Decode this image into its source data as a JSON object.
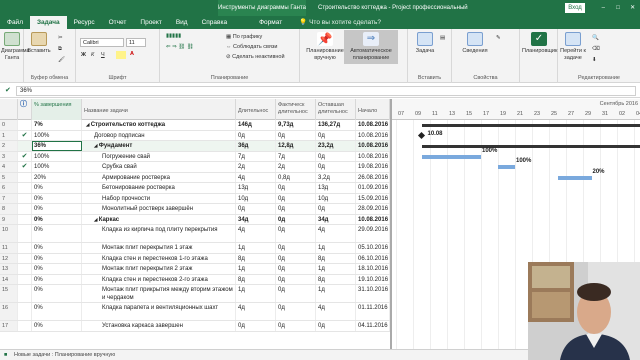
{
  "titlebar": {
    "context_tab": "Инструменты диаграммы Ганта",
    "title": "Строительство коттеджа - Project профессиональный",
    "signin": "Вход",
    "minimize": "–",
    "maximize": "□",
    "close": "✕"
  },
  "tabs": [
    "Файл",
    "Задача",
    "Ресурс",
    "Отчет",
    "Проект",
    "Вид",
    "Справка"
  ],
  "format_tab": "Формат",
  "tell_me": "Что вы хотите сделать?",
  "ribbon": {
    "view_btn": "Диаграмма Ганта",
    "paste_btn": "Вставить",
    "clipboard_label": "Буфер обмена",
    "font_name": "Calibri",
    "font_size": "11",
    "bold": "Ж",
    "italic": "К",
    "underline": "Ч",
    "font_label": "Шрифт",
    "by_schedule": "По графику",
    "respect_links": "Соблюдать связи",
    "inactivate": "Сделать неактивной",
    "planning_label": "Планирование",
    "manual_schedule": "Планирование вручную",
    "auto_schedule": "Автоматическое планирование",
    "task_btn": "Задача",
    "insert_label": "Вставить",
    "info_btn": "Сведения",
    "properties_label": "Свойства",
    "planner_btn": "Планировщик",
    "goto_btn": "Перейти к задаче",
    "editing_label": "Редактирование"
  },
  "formula_value": "36%",
  "headers": {
    "pct": "% завершения",
    "name": "Название задачи",
    "duration": "Длительнос",
    "actual_duration": "Фактическ длительнос",
    "remaining_duration": "Оставшая длительнос",
    "start": "Начало"
  },
  "rows": [
    {
      "n": "0",
      "check": "",
      "pct": "7%",
      "name": "Строительство коттеджа",
      "dur": "146д",
      "act": "9,73д",
      "rem": "136,27д",
      "start": "10.08.2016",
      "level": 0,
      "bold": true,
      "summary": true
    },
    {
      "n": "1",
      "check": "✔",
      "pct": "100%",
      "name": "Договор подписан",
      "dur": "0д",
      "act": "0д",
      "rem": "0д",
      "start": "10.08.2016",
      "level": 1,
      "bold": false,
      "summary": false
    },
    {
      "n": "2",
      "check": "",
      "pct": "36%",
      "name": "Фундамент",
      "dur": "36д",
      "act": "12,8д",
      "rem": "23,2д",
      "start": "10.08.2016",
      "level": 1,
      "bold": true,
      "summary": true
    },
    {
      "n": "3",
      "check": "✔",
      "pct": "100%",
      "name": "Погружение свай",
      "dur": "7д",
      "act": "7д",
      "rem": "0д",
      "start": "10.08.2016",
      "level": 2,
      "bold": false,
      "summary": false
    },
    {
      "n": "4",
      "check": "✔",
      "pct": "100%",
      "name": "Срубка свай",
      "dur": "2д",
      "act": "2д",
      "rem": "0д",
      "start": "19.08.2016",
      "level": 2,
      "bold": false,
      "summary": false
    },
    {
      "n": "5",
      "check": "",
      "pct": "20%",
      "name": "Армирование ростверка",
      "dur": "4д",
      "act": "0,8д",
      "rem": "3,2д",
      "start": "26.08.2016",
      "level": 2,
      "bold": false,
      "summary": false
    },
    {
      "n": "6",
      "check": "",
      "pct": "0%",
      "name": "Бетонирование ростверка",
      "dur": "13д",
      "act": "0д",
      "rem": "13д",
      "start": "01.09.2016",
      "level": 2,
      "bold": false,
      "summary": false
    },
    {
      "n": "7",
      "check": "",
      "pct": "0%",
      "name": "Набор прочности",
      "dur": "10д",
      "act": "0д",
      "rem": "10д",
      "start": "15.09.2016",
      "level": 2,
      "bold": false,
      "summary": false
    },
    {
      "n": "8",
      "check": "",
      "pct": "0%",
      "name": "Монолитный ростверк завершён",
      "dur": "0д",
      "act": "0д",
      "rem": "0д",
      "start": "28.09.2016",
      "level": 2,
      "bold": false,
      "summary": false
    },
    {
      "n": "9",
      "check": "",
      "pct": "0%",
      "name": "Каркас",
      "dur": "34д",
      "act": "0д",
      "rem": "34д",
      "start": "10.08.2016",
      "level": 1,
      "bold": true,
      "summary": true
    },
    {
      "n": "10",
      "check": "",
      "pct": "0%",
      "name": "Кладка из кирпича под плиту перекрытия",
      "dur": "4д",
      "act": "0д",
      "rem": "4д",
      "start": "29.09.2016",
      "level": 2,
      "bold": false,
      "summary": false,
      "tall": true
    },
    {
      "n": "11",
      "check": "",
      "pct": "0%",
      "name": "Монтаж плит перекрытия 1 этаж",
      "dur": "1д",
      "act": "0д",
      "rem": "1д",
      "start": "05.10.2016",
      "level": 2,
      "bold": false,
      "summary": false
    },
    {
      "n": "12",
      "check": "",
      "pct": "0%",
      "name": "Кладка стен и перестенков 1-го этажа",
      "dur": "8д",
      "act": "0д",
      "rem": "8д",
      "start": "06.10.2016",
      "level": 2,
      "bold": false,
      "summary": false
    },
    {
      "n": "13",
      "check": "",
      "pct": "0%",
      "name": "Монтаж плит перекрытия 2 этаж",
      "dur": "1д",
      "act": "0д",
      "rem": "1д",
      "start": "18.10.2016",
      "level": 2,
      "bold": false,
      "summary": false
    },
    {
      "n": "14",
      "check": "",
      "pct": "0%",
      "name": "Кладка стен и перестенков 2-го этажа",
      "dur": "8д",
      "act": "0д",
      "rem": "8д",
      "start": "19.10.2016",
      "level": 2,
      "bold": false,
      "summary": false
    },
    {
      "n": "15",
      "check": "",
      "pct": "0%",
      "name": "Монтаж плит прикрытия между вторим этажом и чердаком",
      "dur": "1д",
      "act": "0д",
      "rem": "1д",
      "start": "31.10.2016",
      "level": 2,
      "bold": false,
      "summary": false,
      "tall": true
    },
    {
      "n": "16",
      "check": "",
      "pct": "0%",
      "name": "Кладка парапета и вентиляционных шахт",
      "dur": "4д",
      "act": "0д",
      "rem": "4д",
      "start": "01.11.2016",
      "level": 2,
      "bold": false,
      "summary": false,
      "tall": true
    },
    {
      "n": "17",
      "check": "",
      "pct": "0%",
      "name": "Установка каркаса завершен",
      "dur": "0д",
      "act": "0д",
      "rem": "0д",
      "start": "04.11.2016",
      "level": 2,
      "bold": false,
      "summary": false
    }
  ],
  "timeline": {
    "month": "Сентябрь 2016",
    "days": [
      "07",
      "09",
      "11",
      "13",
      "15",
      "17",
      "19",
      "21",
      "23",
      "25",
      "27",
      "29",
      "31",
      "02",
      "04"
    ]
  },
  "gantt_labels": {
    "milestone": "10.08",
    "bar3": "100%",
    "bar4": "100%",
    "bar5": "20%"
  },
  "status": {
    "new_tasks": "Новые задачи : Планирование вручную"
  }
}
